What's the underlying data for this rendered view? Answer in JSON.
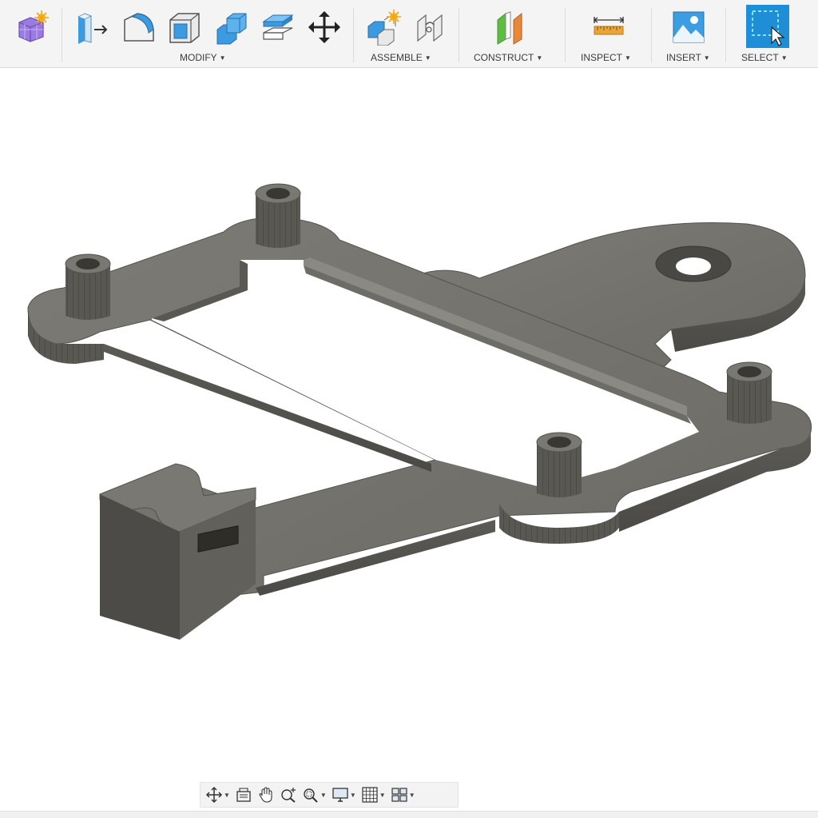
{
  "toolbar": {
    "groups": {
      "modify": "MODIFY",
      "assemble": "ASSEMBLE",
      "construct": "CONSTRUCT",
      "inspect": "INSPECT",
      "insert": "INSERT",
      "select": "SELECT"
    },
    "icons": [
      "create-form-icon",
      "press-pull-icon",
      "fillet-icon",
      "shell-icon",
      "combine-icon",
      "offset-face-icon",
      "move-icon",
      "new-component-icon",
      "joint-icon",
      "offset-plane-icon",
      "measure-icon",
      "insert-image-icon",
      "select-box-icon"
    ],
    "colors": {
      "accent_blue": "#1e8fd6",
      "form_purple": "#8e6bd8",
      "construct_orange": "#e08a3c",
      "construct_green": "#6cc04a",
      "ruler_gold": "#e8a53a"
    }
  },
  "viewport": {
    "model": "3D part - bracket with four standoffs",
    "model_color": "#75736d"
  },
  "navbar": {
    "icons": [
      "orbit-icon",
      "look-at-icon",
      "pan-icon",
      "zoom-icon",
      "zoom-window-icon",
      "display-settings-icon",
      "grid-settings-icon",
      "viewports-icon"
    ]
  }
}
